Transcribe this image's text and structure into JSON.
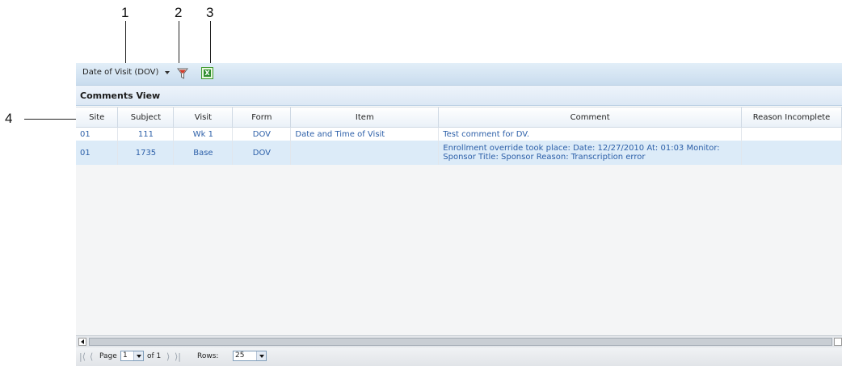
{
  "callouts": [
    "1",
    "2",
    "3",
    "4"
  ],
  "toolbar": {
    "view_selector_label": "Date of Visit (DOV)",
    "filter_icon": "filter-icon",
    "export_icon": "excel-export-icon"
  },
  "view_title": "Comments View",
  "table": {
    "columns": [
      "Site",
      "Subject",
      "Visit",
      "Form",
      "Item",
      "Comment",
      "Reason Incomplete"
    ],
    "rows": [
      {
        "site": "01",
        "subject": "111",
        "visit": "Wk 1",
        "form": "DOV",
        "item": "Date and Time of Visit",
        "comment": "Test comment for DV.",
        "reason": ""
      },
      {
        "site": "01",
        "subject": "1735",
        "visit": "Base",
        "form": "DOV",
        "item": "",
        "comment": "Enrollment override took place: Date: 12/27/2010 At: 01:03 Monitor: Sponsor Title: Sponsor Reason: Transcription error",
        "reason": ""
      }
    ]
  },
  "pager": {
    "page_label": "Page",
    "page_value": "1",
    "of_label": "of 1",
    "rows_label": "Rows:",
    "rows_value": "25"
  },
  "colors": {
    "toolbar_bg": "#c9dcee",
    "link_text": "#2c5fa8",
    "alt_row": "#dcebf8"
  }
}
